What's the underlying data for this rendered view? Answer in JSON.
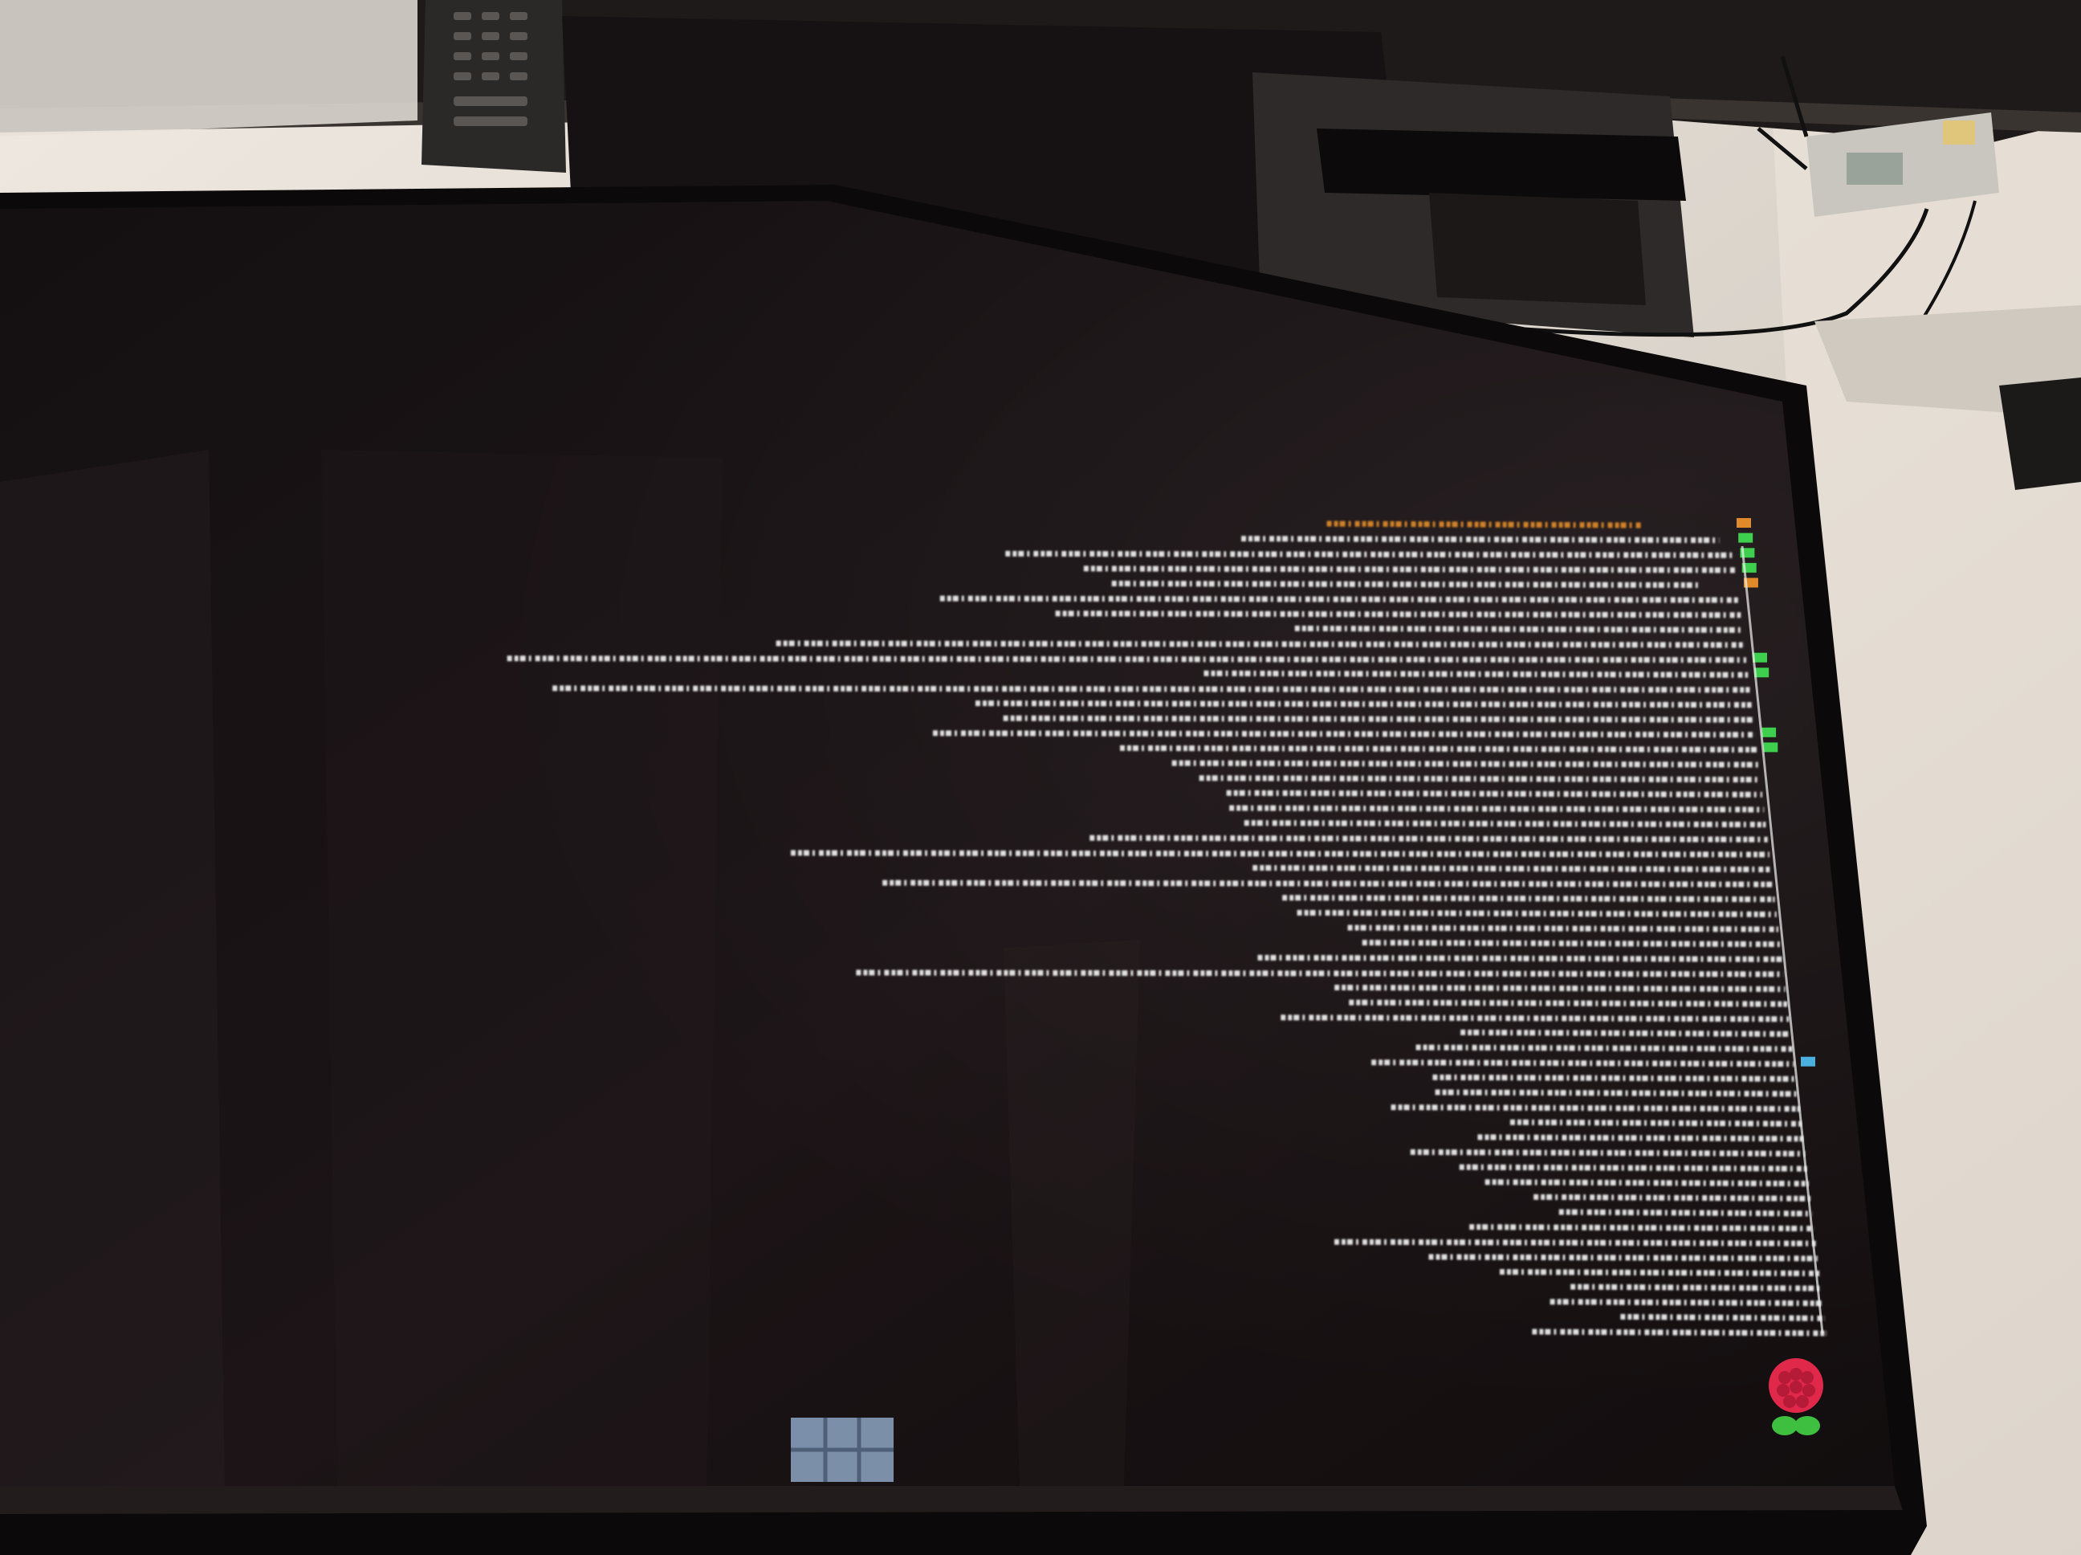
{
  "colors": {
    "wall": "#d9d3cc",
    "tv_bezel": "#0b0909",
    "screen_bg": "#1a1314",
    "console_text": "#f2f2f2",
    "status_ok": "#3fcf4f",
    "status_warn": "#e08a2a",
    "status_info": "#4ab0e0",
    "logo_berry": "#e0284a",
    "logo_leaf": "#3fbf3f",
    "standby_led": "#ff2020"
  },
  "icons": {
    "logo": "raspberry-pi-logo",
    "led": "standby-led"
  },
  "console": {
    "orientation": "upside-down",
    "lines": [
      {
        "indent": 0.07,
        "length": 0.25,
        "status": "warn"
      },
      {
        "indent": 0.01,
        "length": 0.38,
        "status": "ok"
      },
      {
        "indent": 0.0,
        "length": 0.58,
        "status": "ok"
      },
      {
        "indent": 0.0,
        "length": 0.52,
        "status": "ok"
      },
      {
        "indent": 0.03,
        "length": 0.47,
        "status": "warn"
      },
      {
        "indent": 0.0,
        "length": 0.64,
        "status": "none"
      },
      {
        "indent": 0.0,
        "length": 0.55,
        "status": "none"
      },
      {
        "indent": 0.0,
        "length": 0.36,
        "status": "none"
      },
      {
        "indent": 0.0,
        "length": 0.78,
        "status": "none"
      },
      {
        "indent": 0.0,
        "length": 1.0,
        "status": "ok"
      },
      {
        "indent": 0.0,
        "length": 0.44,
        "status": "ok"
      },
      {
        "indent": 0.0,
        "length": 0.97,
        "status": "none"
      },
      {
        "indent": 0.0,
        "length": 0.63,
        "status": "none"
      },
      {
        "indent": 0.0,
        "length": 0.61,
        "status": "none"
      },
      {
        "indent": 0.0,
        "length": 0.67,
        "status": "ok"
      },
      {
        "indent": 0.0,
        "length": 0.52,
        "status": "ok"
      },
      {
        "indent": 0.0,
        "length": 0.48,
        "status": "none"
      },
      {
        "indent": 0.0,
        "length": 0.46,
        "status": "none"
      },
      {
        "indent": 0.0,
        "length": 0.44,
        "status": "none"
      },
      {
        "indent": 0.0,
        "length": 0.44,
        "status": "none"
      },
      {
        "indent": 0.0,
        "length": 0.43,
        "status": "none"
      },
      {
        "indent": 0.0,
        "length": 0.56,
        "status": "none"
      },
      {
        "indent": 0.0,
        "length": 0.81,
        "status": "none"
      },
      {
        "indent": 0.0,
        "length": 0.43,
        "status": "none"
      },
      {
        "indent": 0.0,
        "length": 0.74,
        "status": "none"
      },
      {
        "indent": 0.0,
        "length": 0.41,
        "status": "none"
      },
      {
        "indent": 0.0,
        "length": 0.4,
        "status": "none"
      },
      {
        "indent": 0.0,
        "length": 0.36,
        "status": "none"
      },
      {
        "indent": 0.0,
        "length": 0.35,
        "status": "none"
      },
      {
        "indent": 0.0,
        "length": 0.44,
        "status": "none"
      },
      {
        "indent": 0.0,
        "length": 0.78,
        "status": "none"
      },
      {
        "indent": 0.0,
        "length": 0.38,
        "status": "none"
      },
      {
        "indent": 0.0,
        "length": 0.37,
        "status": "none"
      },
      {
        "indent": 0.0,
        "length": 0.43,
        "status": "none"
      },
      {
        "indent": 0.0,
        "length": 0.28,
        "status": "none"
      },
      {
        "indent": 0.0,
        "length": 0.32,
        "status": "none"
      },
      {
        "indent": 0.0,
        "length": 0.36,
        "status": "info"
      },
      {
        "indent": 0.0,
        "length": 0.31,
        "status": "none"
      },
      {
        "indent": 0.0,
        "length": 0.31,
        "status": "none"
      },
      {
        "indent": 0.0,
        "length": 0.35,
        "status": "none"
      },
      {
        "indent": 0.0,
        "length": 0.25,
        "status": "none"
      },
      {
        "indent": 0.0,
        "length": 0.28,
        "status": "none"
      },
      {
        "indent": 0.0,
        "length": 0.34,
        "status": "none"
      },
      {
        "indent": 0.0,
        "length": 0.3,
        "status": "none"
      },
      {
        "indent": 0.0,
        "length": 0.28,
        "status": "none"
      },
      {
        "indent": 0.0,
        "length": 0.24,
        "status": "none"
      },
      {
        "indent": 0.0,
        "length": 0.22,
        "status": "none"
      },
      {
        "indent": 0.0,
        "length": 0.3,
        "status": "none"
      },
      {
        "indent": 0.0,
        "length": 0.42,
        "status": "none"
      },
      {
        "indent": 0.0,
        "length": 0.34,
        "status": "none"
      },
      {
        "indent": 0.0,
        "length": 0.28,
        "status": "none"
      },
      {
        "indent": 0.0,
        "length": 0.22,
        "status": "none"
      },
      {
        "indent": 0.0,
        "length": 0.24,
        "status": "none"
      },
      {
        "indent": 0.0,
        "length": 0.18,
        "status": "none"
      },
      {
        "indent": 0.0,
        "length": 0.26,
        "status": "none"
      }
    ]
  }
}
